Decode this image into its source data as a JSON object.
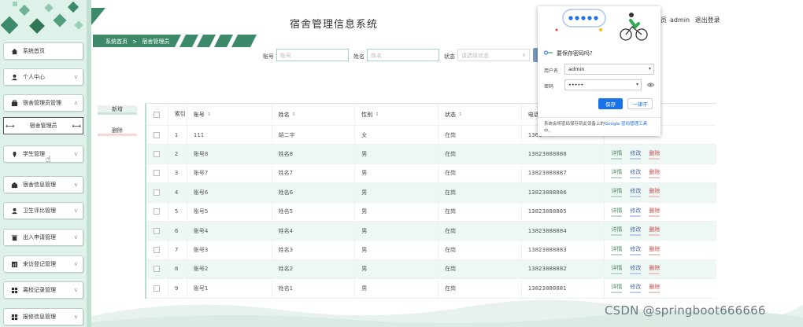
{
  "header": {
    "title": "宿舍管理信息系统",
    "user": "admin",
    "logout": "退出登录",
    "user_prefix": "员"
  },
  "breadcrumb": {
    "home": "系统首页",
    "sep": ">",
    "current": "宿舍管理员"
  },
  "sidebar": {
    "items": [
      {
        "label": "系统首页",
        "icon": "home-icon"
      },
      {
        "label": "个人中心",
        "icon": "user-icon"
      },
      {
        "label": "宿舍管理员管理",
        "icon": "briefcase-icon"
      },
      {
        "label": "宿舍管理员",
        "icon": ""
      },
      {
        "label": "学生管理",
        "icon": "pin-icon"
      },
      {
        "label": "宿舍信息管理",
        "icon": "building-icon"
      },
      {
        "label": "卫生评比管理",
        "icon": "user-icon"
      },
      {
        "label": "出入申请管理",
        "icon": "trash-icon"
      },
      {
        "label": "来访登记管理",
        "icon": "chart-icon"
      },
      {
        "label": "离校记录管理",
        "icon": "grid-icon"
      },
      {
        "label": "报修信息管理",
        "icon": "grid-icon"
      }
    ]
  },
  "search": {
    "account_label": "账号",
    "account_placeholder": "账号",
    "name_label": "姓名",
    "name_placeholder": "姓名",
    "status_label": "状态",
    "status_placeholder": "请选择状态"
  },
  "actions": {
    "add": "新增",
    "delete": "删除"
  },
  "table": {
    "headers": {
      "index": "索引",
      "account": "账号",
      "name": "姓名",
      "sex": "性别",
      "status": "状态",
      "phone": "电话"
    },
    "op_labels": {
      "view": "详情",
      "edit": "修改",
      "del": "删除"
    },
    "rows": [
      {
        "idx": "1",
        "account": "111",
        "name": "胡二宇",
        "sex": "女",
        "status": "在岗",
        "phone": "1363",
        "ops": false
      },
      {
        "idx": "2",
        "account": "账号8",
        "name": "姓名8",
        "sex": "男",
        "status": "在岗",
        "phone": "13823888888",
        "ops": true
      },
      {
        "idx": "3",
        "account": "账号7",
        "name": "姓名7",
        "sex": "男",
        "status": "在岗",
        "phone": "13823888887",
        "ops": true
      },
      {
        "idx": "4",
        "account": "账号6",
        "name": "姓名6",
        "sex": "男",
        "status": "在岗",
        "phone": "13823888886",
        "ops": true
      },
      {
        "idx": "5",
        "account": "账号5",
        "name": "姓名5",
        "sex": "男",
        "status": "在岗",
        "phone": "13823888885",
        "ops": true
      },
      {
        "idx": "6",
        "account": "账号4",
        "name": "姓名4",
        "sex": "男",
        "status": "在岗",
        "phone": "13823888884",
        "ops": true
      },
      {
        "idx": "7",
        "account": "账号3",
        "name": "姓名3",
        "sex": "男",
        "status": "在岗",
        "phone": "13823888883",
        "ops": true
      },
      {
        "idx": "8",
        "account": "账号2",
        "name": "姓名2",
        "sex": "男",
        "status": "在岗",
        "phone": "13823888882",
        "ops": true
      },
      {
        "idx": "9",
        "account": "账号1",
        "name": "姓名1",
        "sex": "男",
        "status": "在岗",
        "phone": "13823888881",
        "ops": true
      }
    ]
  },
  "popup": {
    "title": "要保存密码吗?",
    "username_label": "用户名",
    "username_value": "admin",
    "password_label": "密码",
    "password_value": "•••••",
    "save": "保存",
    "never": "一律不",
    "footer_pre": "系统会将密码保存到此设备上的",
    "footer_link": "Google 密码管理工具",
    "footer_post": "中。"
  },
  "watermark": "CSDN @springboot666666",
  "colors": {
    "theme_green": "#3d8a6a",
    "sidebar_bg": "#dff2e9",
    "row_alt": "#edf7f3",
    "save_blue": "#1a73e8"
  }
}
